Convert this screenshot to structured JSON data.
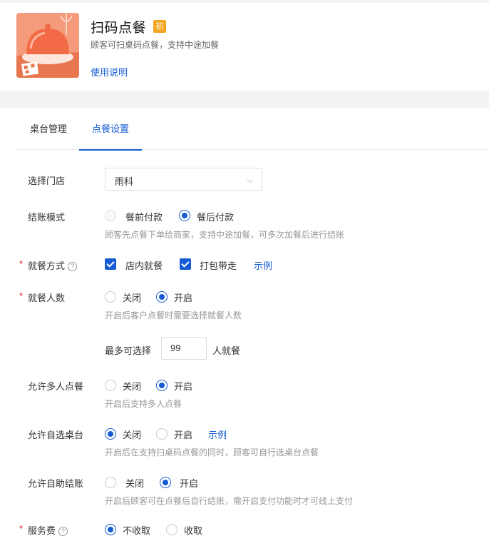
{
  "app": {
    "title": "扫码点餐",
    "badge": "初",
    "desc": "顾客可扫桌码点餐，支持中途加餐",
    "help_link": "使用说明"
  },
  "tabs": [
    {
      "label": "桌台管理",
      "active": false
    },
    {
      "label": "点餐设置",
      "active": true
    }
  ],
  "form": {
    "store": {
      "label": "选择门店",
      "value": "雨科"
    },
    "checkout_mode": {
      "label": "结账模式",
      "options": [
        "餐前付款",
        "餐后付款"
      ],
      "selected": "餐后付款",
      "hint": "顾客先点餐下单给商家，支持中途加餐，可多次加餐后进行结账"
    },
    "dining_method": {
      "required_mark": "*",
      "label": "就餐方式",
      "help_icon": "?",
      "options": [
        "店内就餐",
        "打包带走"
      ],
      "checked": [
        "店内就餐",
        "打包带走"
      ],
      "example": "示例"
    },
    "diners": {
      "required_mark": "*",
      "label": "就餐人数",
      "options": [
        "关闭",
        "开启"
      ],
      "selected": "开启",
      "hint": "开启后客户点餐时需要选择就餐人数",
      "max_prefix": "最多可选择",
      "max_value": "99",
      "max_suffix": "人就餐"
    },
    "multi_order": {
      "label": "允许多人点餐",
      "options": [
        "关闭",
        "开启"
      ],
      "selected": "开启",
      "hint": "开启后支持多人点餐"
    },
    "self_table": {
      "label": "允许自选桌台",
      "options": [
        "关闭",
        "开启"
      ],
      "selected": "关闭",
      "example": "示例",
      "hint": "开启后在支持扫桌码点餐的同时，顾客可自行选桌台点餐"
    },
    "self_checkout": {
      "label": "允许自助结账",
      "options": [
        "关闭",
        "开启"
      ],
      "selected": "开启",
      "hint": "开启后顾客可在点餐后自行结账，需开启支付功能时才可线上支付"
    },
    "service_fee": {
      "required_mark": "*",
      "label": "服务费",
      "help_icon": "?",
      "options": [
        "不收取",
        "收取"
      ],
      "selected": "不收取"
    }
  },
  "colors": {
    "accent": "#155bd4",
    "required": "#e02020",
    "badge": "#f5a623",
    "thumb_bg": "#f59a7a"
  }
}
